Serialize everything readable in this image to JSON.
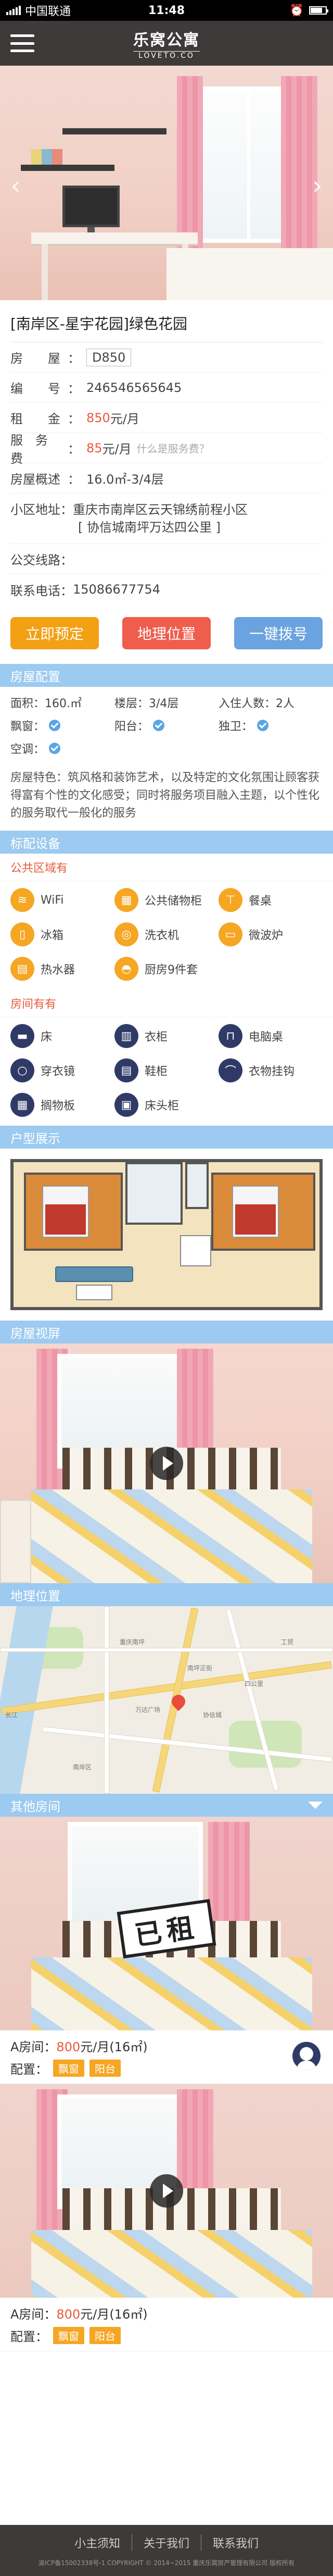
{
  "status_bar": {
    "carrier": "中国联通",
    "time": "11:48"
  },
  "brand": {
    "name": "乐窝公寓",
    "domain": "LOVETO.CO"
  },
  "room": {
    "title": "[南岸区-星宇花园]绿色花园",
    "fields": [
      {
        "label": "房　　屋",
        "value": "D850",
        "type": "code"
      },
      {
        "label": "编　　号",
        "value": "246546565645",
        "type": "text"
      },
      {
        "label": "租　　金",
        "value": "850",
        "unit": "元/月",
        "type": "price"
      },
      {
        "label": "服　务　费",
        "value": "85",
        "unit": "元/月",
        "hint": "什么是服务费？",
        "type": "fee"
      },
      {
        "label": "房屋概述",
        "value": "16.0㎡-3/4层",
        "type": "text"
      }
    ],
    "address_label": "小区地址",
    "address_line1": "重庆市南岸区云天锦绣前程小区",
    "address_line2": "[ 协信城南坪万达四公里 ]",
    "transit_label": "公交线路",
    "transit_value": "",
    "phone_label": "联系电话",
    "phone_value": "15086677754"
  },
  "actions": {
    "book": "立即预定",
    "location": "地理位置",
    "call": "一键拨号"
  },
  "config": {
    "header": "房屋配置",
    "rows": [
      [
        "面积：160.㎡",
        "楼层：3/4层",
        "入住人数：2人"
      ],
      [
        "飘窗：",
        "阳台：",
        "独卫："
      ],
      [
        "空调：",
        "",
        ""
      ]
    ],
    "desc": "房屋特色：筑风格和装饰艺术，以及特定的文化氛围让顾客获得富有个性的文化感受；同时将服务项目融入主题，以个性化的服务取代一般化的服务"
  },
  "facilities": {
    "header": "标配设备",
    "public_title": "公共区域有",
    "public": [
      {
        "icon": "wifi-icon",
        "glyph": "≋",
        "label": "WiFi"
      },
      {
        "icon": "storage-cabinet-icon",
        "glyph": "▦",
        "label": "公共储物柜"
      },
      {
        "icon": "dining-table-icon",
        "glyph": "⊤",
        "label": "餐桌"
      },
      {
        "icon": "fridge-icon",
        "glyph": "▯",
        "label": "冰箱"
      },
      {
        "icon": "washing-machine-icon",
        "glyph": "◎",
        "label": "洗衣机"
      },
      {
        "icon": "microwave-icon",
        "glyph": "▭",
        "label": "微波炉"
      },
      {
        "icon": "water-heater-icon",
        "glyph": "▤",
        "label": "热水器"
      },
      {
        "icon": "kitchenware-icon",
        "glyph": "◓",
        "label": "厨房9件套"
      }
    ],
    "room_title": "房间有有",
    "room": [
      {
        "icon": "bed-icon",
        "glyph": "▬",
        "label": "床"
      },
      {
        "icon": "wardrobe-icon",
        "glyph": "▥",
        "label": "衣柜"
      },
      {
        "icon": "computer-desk-icon",
        "glyph": "⊓",
        "label": "电脑桌"
      },
      {
        "icon": "mirror-icon",
        "glyph": "○",
        "label": "穿衣镜"
      },
      {
        "icon": "shoe-cabinet-icon",
        "glyph": "▤",
        "label": "鞋柜"
      },
      {
        "icon": "hanger-icon",
        "glyph": "⌒",
        "label": "衣物挂钩"
      },
      {
        "icon": "shelf-icon",
        "glyph": "▦",
        "label": "搁物板"
      },
      {
        "icon": "nightstand-icon",
        "glyph": "▣",
        "label": "床头柜"
      }
    ]
  },
  "floorplan_header": "户型展示",
  "video_header": "房屋视屏",
  "map": {
    "header": "地理位置",
    "labels": [
      "重庆南坪",
      "南坪正街",
      "万达广场",
      "协信城",
      "四公里",
      "南岸区",
      "工贸",
      "长江"
    ]
  },
  "others": {
    "header": "其他房间",
    "listings": [
      {
        "name": "A房间",
        "price": "800",
        "unit": "元/月(16㎡)",
        "config_label": "配置：",
        "tags": [
          "飘窗",
          "阳台"
        ],
        "stamp": "已租"
      },
      {
        "name": "A房间",
        "price": "800",
        "unit": "元/月(16㎡)",
        "config_label": "配置：",
        "tags": [
          "飘窗",
          "阳台"
        ]
      }
    ]
  },
  "footer": {
    "links": [
      "小主须知",
      "关于我们",
      "联系我们"
    ],
    "copyright": "渝ICP备15002338号-1  COPYRIGHT © 2014~2015  重庆乐窝房产管理有限公司 版权所有"
  },
  "colors": {
    "accent_orange": "#f3a014",
    "accent_red": "#ef5d4d",
    "accent_blue": "#6aa3df",
    "section_blue": "#9ccaf0",
    "nav_dark": "#3e3a39",
    "icon_navy": "#2f3b66"
  }
}
